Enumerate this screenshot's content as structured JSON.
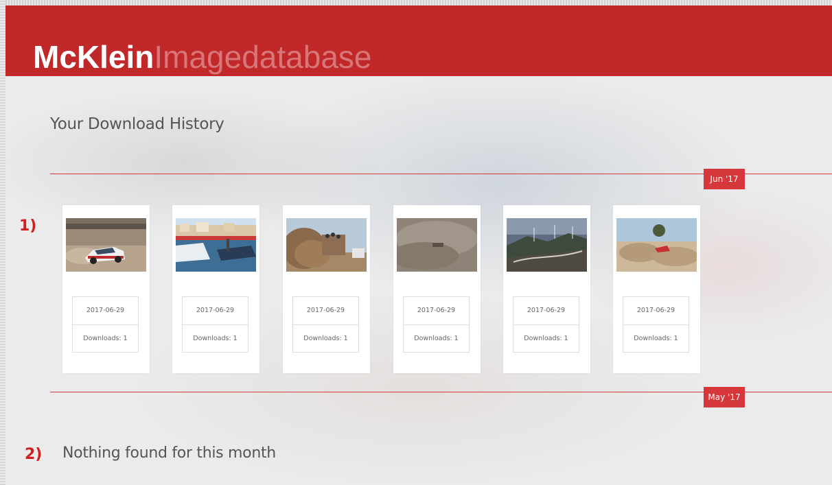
{
  "brand": {
    "strong": "McKlein",
    "light": "Imagedatabase"
  },
  "page_title": "Your Download History",
  "months": [
    {
      "label": "Jun '17",
      "annotation": "1)"
    },
    {
      "label": "May '17",
      "annotation": "2)",
      "empty_message": "Nothing found for this month"
    }
  ],
  "downloads": [
    {
      "image": "rally-car-cornering-photo",
      "date": "2017-06-29",
      "downloads": "Downloads: 1"
    },
    {
      "image": "harbor-boats-photo",
      "date": "2017-06-29",
      "downloads": "Downloads: 1"
    },
    {
      "image": "dust-spectators-photo",
      "date": "2017-06-29",
      "downloads": "Downloads: 1"
    },
    {
      "image": "dust-cloud-photo",
      "date": "2017-06-29",
      "downloads": "Downloads: 1"
    },
    {
      "image": "hills-wind-turbines-photo",
      "date": "2017-06-29",
      "downloads": "Downloads: 1"
    },
    {
      "image": "rally-car-dust-photo",
      "date": "2017-06-29",
      "downloads": "Downloads: 1"
    }
  ],
  "colors": {
    "brand_red": "#c0282a",
    "badge_red": "#d6373a",
    "annotation_red": "#d11f21"
  }
}
